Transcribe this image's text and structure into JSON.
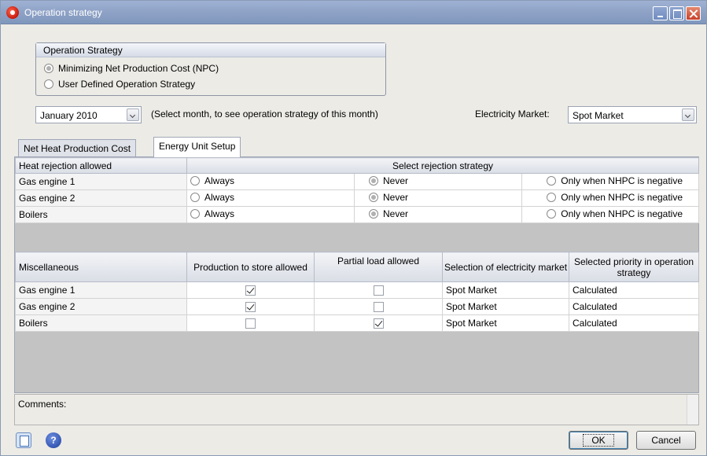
{
  "window": {
    "title": "Operation strategy"
  },
  "strategy_group": {
    "heading": "Operation Strategy",
    "options": [
      {
        "label": "Minimizing Net Production Cost (NPC)",
        "selected": true
      },
      {
        "label": "User Defined Operation Strategy",
        "selected": false
      }
    ]
  },
  "month_select": {
    "value": "January 2010"
  },
  "month_hint": "(Select month, to see operation strategy of this month)",
  "market": {
    "label": "Electricity Market:",
    "value": "Spot Market"
  },
  "tabs": [
    {
      "label": "Net Heat Production Cost",
      "active": false
    },
    {
      "label": "Energy Unit Setup",
      "active": true
    }
  ],
  "rejection": {
    "headers": [
      "Heat rejection allowed",
      "Select rejection strategy"
    ],
    "option_labels": [
      "Always",
      "Never",
      "Only when NHPC is negative"
    ],
    "rows": [
      {
        "unit": "Gas engine 1",
        "selected": "Never"
      },
      {
        "unit": "Gas engine 2",
        "selected": "Never"
      },
      {
        "unit": "Boilers",
        "selected": "Never"
      }
    ]
  },
  "misc": {
    "headers": [
      "Miscellaneous",
      "Production to store allowed",
      "Partial load allowed",
      "Selection of electricity market",
      "Selected priority in operation strategy"
    ],
    "rows": [
      {
        "unit": "Gas engine 1",
        "store": true,
        "partial": false,
        "market": "Spot Market",
        "priority": "Calculated"
      },
      {
        "unit": "Gas engine 2",
        "store": true,
        "partial": false,
        "market": "Spot Market",
        "priority": "Calculated"
      },
      {
        "unit": "Boilers",
        "store": false,
        "partial": true,
        "market": "Spot Market",
        "priority": "Calculated"
      }
    ]
  },
  "comments": {
    "label": "Comments:"
  },
  "footer": {
    "ok_label": "OK",
    "cancel_label": "Cancel",
    "help_label": "?"
  },
  "icons": [
    "app-icon",
    "minimize-icon",
    "maximize-icon",
    "close-icon",
    "document-icon",
    "help-icon",
    "chevron-down-icon"
  ]
}
